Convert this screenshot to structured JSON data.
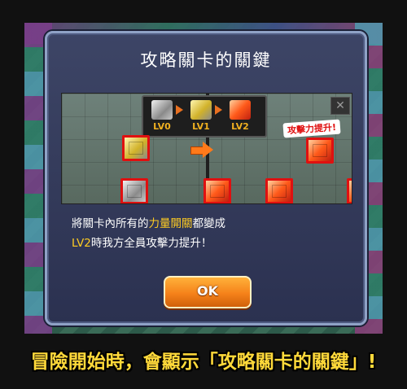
{
  "dialog": {
    "title": "攻略關卡的關鍵",
    "preview": {
      "levels": [
        "LV0",
        "LV1",
        "LV2"
      ],
      "attack_badge": "攻擊力提升!",
      "close_icon": "close-icon"
    },
    "description": {
      "line1_pre": "將關卡內所有的",
      "line1_highlight": "力量開關",
      "line1_post": "都變成",
      "line2_highlight": "LV2",
      "line2_post": "時我方全員攻擊力提升！"
    },
    "ok_label": "OK"
  },
  "caption": "冒險開始時，會顯示「攻略關卡的關鍵」!",
  "colors": {
    "accent_text": "#ffcc22",
    "ok_button": "#f5821a",
    "caption": "#ffd93a",
    "block_border": "#e01010"
  }
}
